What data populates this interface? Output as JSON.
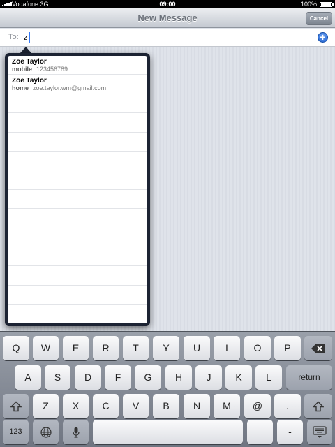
{
  "status_bar": {
    "carrier": "Vodafone 3G",
    "time": "09:00",
    "battery": "100%"
  },
  "nav": {
    "title": "New Message",
    "cancel_label": "Cancel"
  },
  "to_field": {
    "label": "To:",
    "value": "z"
  },
  "suggestions": [
    {
      "name": "Zoe Taylor",
      "type": "mobile",
      "value": "123456789"
    },
    {
      "name": "Zoe Taylor",
      "type": "home",
      "value": "zoe.taylor.wm@gmail.com"
    }
  ],
  "keyboard": {
    "row1": [
      "Q",
      "W",
      "E",
      "R",
      "T",
      "Y",
      "U",
      "I",
      "O",
      "P"
    ],
    "row2": [
      "A",
      "S",
      "D",
      "F",
      "G",
      "H",
      "J",
      "K",
      "L"
    ],
    "row3": [
      "Z",
      "X",
      "C",
      "V",
      "B",
      "N",
      "M",
      "@",
      "."
    ],
    "return_label": "return",
    "numbers_label": "123",
    "underscore_label": "_",
    "dash_label": "-",
    "icons": {
      "backspace": "backspace-icon",
      "shift": "shift-icon",
      "globe": "globe-icon",
      "mic": "microphone-icon",
      "dismiss": "keyboard-dismiss-icon",
      "add_contact": "add-contact-icon"
    }
  }
}
